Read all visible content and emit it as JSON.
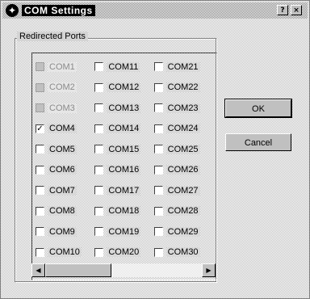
{
  "window": {
    "title": "COM Settings"
  },
  "titlebar_buttons": {
    "help": "?",
    "close": "×"
  },
  "group": {
    "label": "Redirected Ports"
  },
  "ports": [
    [
      {
        "label": "COM1",
        "checked": false,
        "disabled": true
      },
      {
        "label": "COM2",
        "checked": false,
        "disabled": true
      },
      {
        "label": "COM3",
        "checked": false,
        "disabled": true
      },
      {
        "label": "COM4",
        "checked": true,
        "disabled": false
      },
      {
        "label": "COM5",
        "checked": false,
        "disabled": false
      },
      {
        "label": "COM6",
        "checked": false,
        "disabled": false
      },
      {
        "label": "COM7",
        "checked": false,
        "disabled": false
      },
      {
        "label": "COM8",
        "checked": false,
        "disabled": false
      },
      {
        "label": "COM9",
        "checked": false,
        "disabled": false
      },
      {
        "label": "COM10",
        "checked": false,
        "disabled": false
      }
    ],
    [
      {
        "label": "COM11",
        "checked": false,
        "disabled": false
      },
      {
        "label": "COM12",
        "checked": false,
        "disabled": false
      },
      {
        "label": "COM13",
        "checked": false,
        "disabled": false
      },
      {
        "label": "COM14",
        "checked": false,
        "disabled": false
      },
      {
        "label": "COM15",
        "checked": false,
        "disabled": false
      },
      {
        "label": "COM16",
        "checked": false,
        "disabled": false
      },
      {
        "label": "COM17",
        "checked": false,
        "disabled": false
      },
      {
        "label": "COM18",
        "checked": false,
        "disabled": false
      },
      {
        "label": "COM19",
        "checked": false,
        "disabled": false
      },
      {
        "label": "COM20",
        "checked": false,
        "disabled": false
      }
    ],
    [
      {
        "label": "COM21",
        "checked": false,
        "disabled": false
      },
      {
        "label": "COM22",
        "checked": false,
        "disabled": false
      },
      {
        "label": "COM23",
        "checked": false,
        "disabled": false
      },
      {
        "label": "COM24",
        "checked": false,
        "disabled": false
      },
      {
        "label": "COM25",
        "checked": false,
        "disabled": false
      },
      {
        "label": "COM26",
        "checked": false,
        "disabled": false
      },
      {
        "label": "COM27",
        "checked": false,
        "disabled": false
      },
      {
        "label": "COM28",
        "checked": false,
        "disabled": false
      },
      {
        "label": "COM29",
        "checked": false,
        "disabled": false
      },
      {
        "label": "COM30",
        "checked": false,
        "disabled": false
      }
    ]
  ],
  "scrollbar": {
    "left_arrow": "◀",
    "right_arrow": "▶"
  },
  "buttons": {
    "ok": "OK",
    "cancel": "Cancel"
  }
}
